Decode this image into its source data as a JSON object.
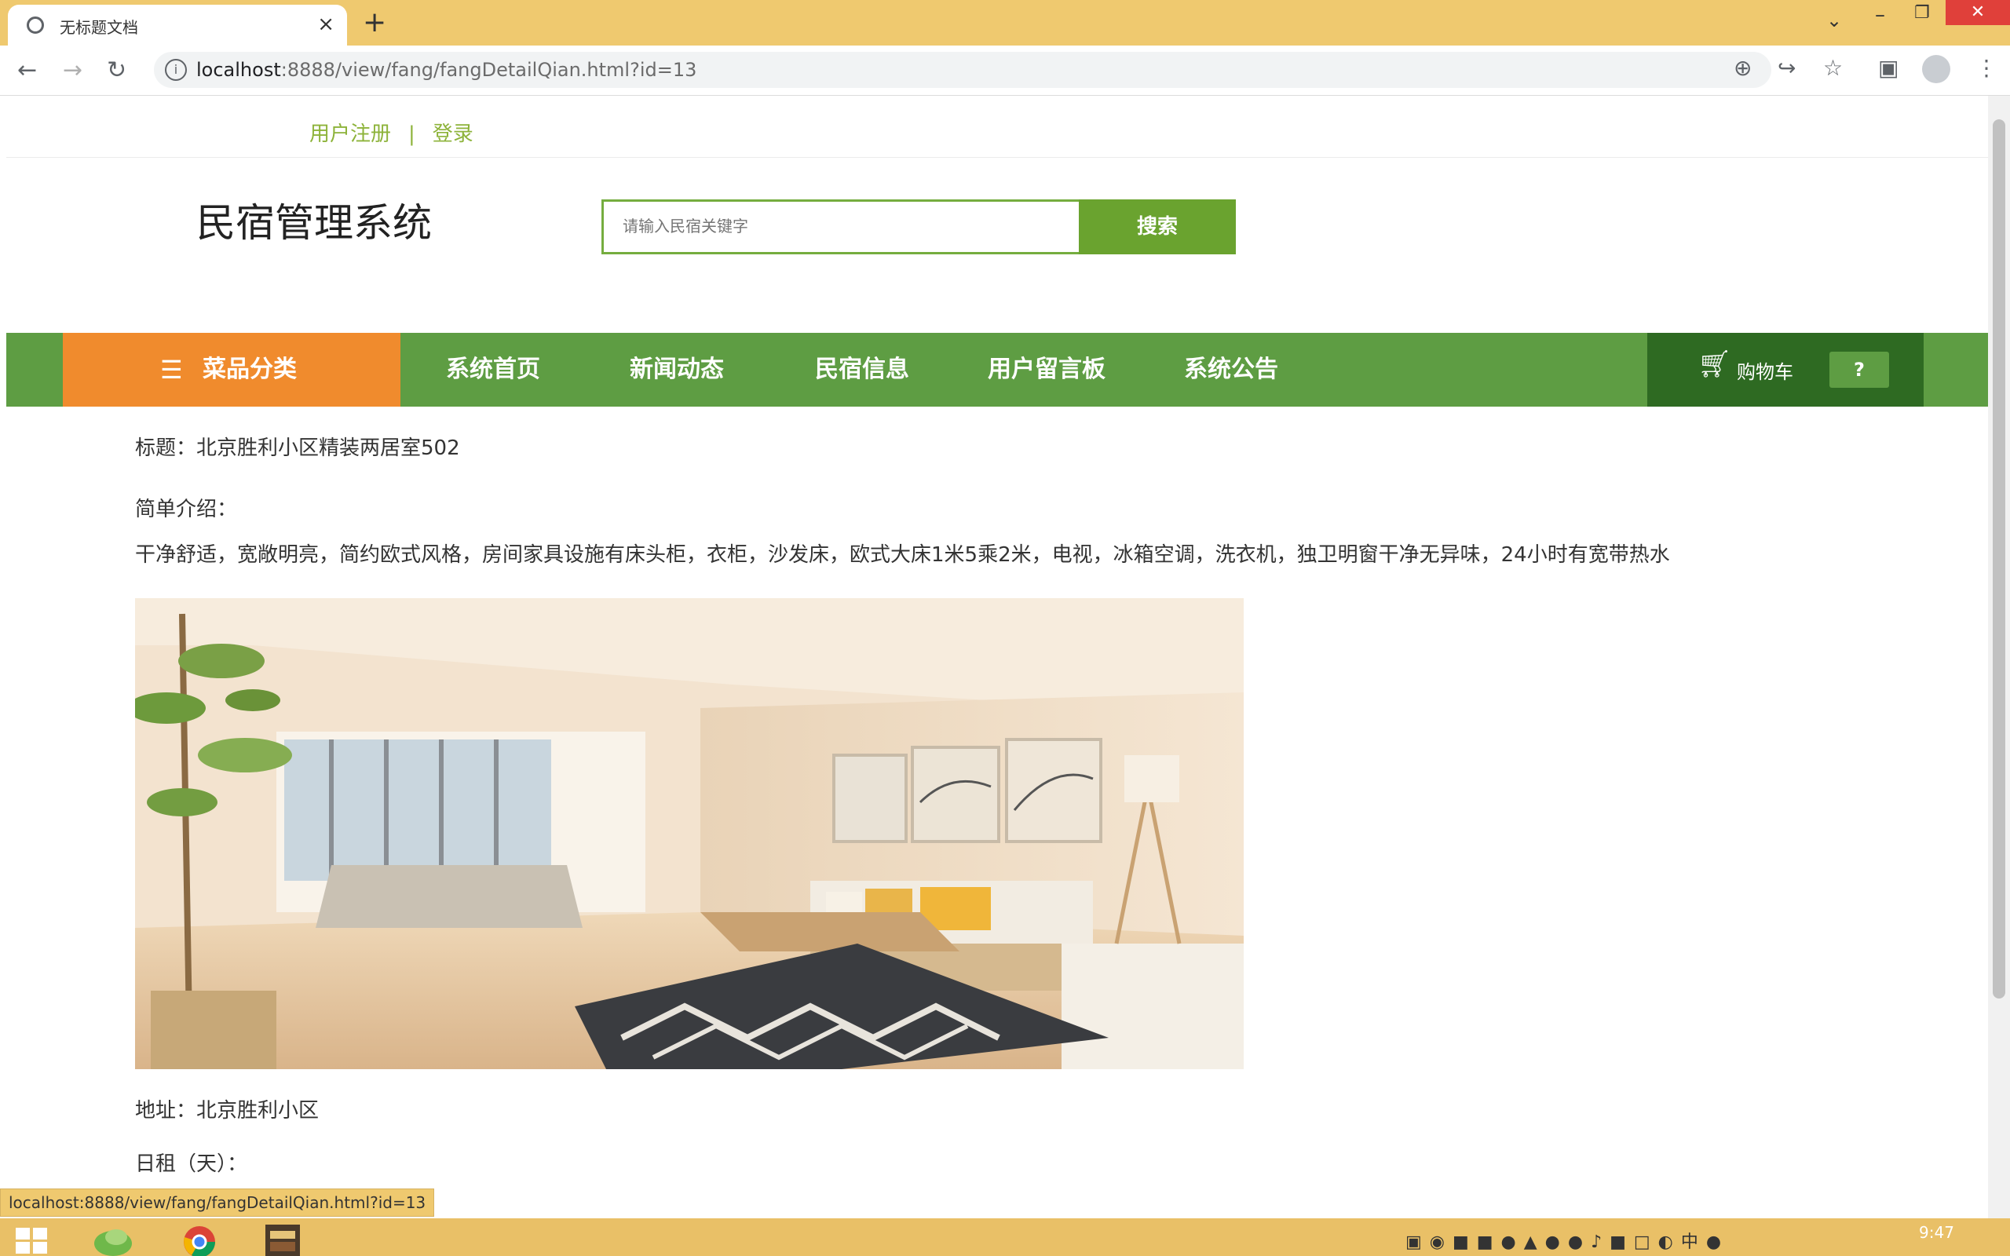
{
  "browser": {
    "tab_title": "无标题文档",
    "new_tab_icon": "+",
    "close_tab_icon": "×",
    "url_host": "localhost",
    "url_path": ":8888/view/fang/fangDetailQian.html?id=13"
  },
  "header": {
    "register_link": "用户注册",
    "separator": "|",
    "login_link": "登录",
    "site_title": "民宿管理系统",
    "search_placeholder": "请输入民宿关键字",
    "search_button": "搜索"
  },
  "nav": {
    "category_label": "菜品分类",
    "items": [
      "系统首页",
      "新闻动态",
      "民宿信息",
      "用户留言板",
      "系统公告"
    ],
    "cart_label": "购物车",
    "cart_badge": "?"
  },
  "detail": {
    "title_label": "标题：北京胜利小区精装两居室502",
    "intro_label": "简单介绍：",
    "intro_text": "干净舒适，宽敞明亮，简约欧式风格，房间家具设施有床头柜，衣柜，沙发床，欧式大床1米5乘2米，电视，冰箱空调，洗衣机，独卫明窗干净无异味，24小时有宽带热水",
    "address_label": "地址：北京胜利小区",
    "rent_label": "日租（天）："
  },
  "status_bar_url": "localhost:8888/view/fang/fangDetailQian.html?id=13",
  "taskbar": {
    "clock": "9:47"
  },
  "colors": {
    "nav_green": "#5e9d43",
    "category_orange": "#f08b2d",
    "cart_dark_green": "#2e6a22",
    "link_green": "#8db33a",
    "search_button_green": "#6aa32f",
    "chrome_yellow": "#efc96f"
  },
  "icons": {
    "category": "list-icon",
    "cart": "cart-icon",
    "reload": "reload-icon",
    "back": "back-arrow-icon",
    "forward": "forward-arrow-icon",
    "zoom": "zoom-icon",
    "share": "share-icon",
    "bookmark": "star-icon",
    "sidepanel": "side-panel-icon",
    "menu": "kebab-menu-icon"
  }
}
